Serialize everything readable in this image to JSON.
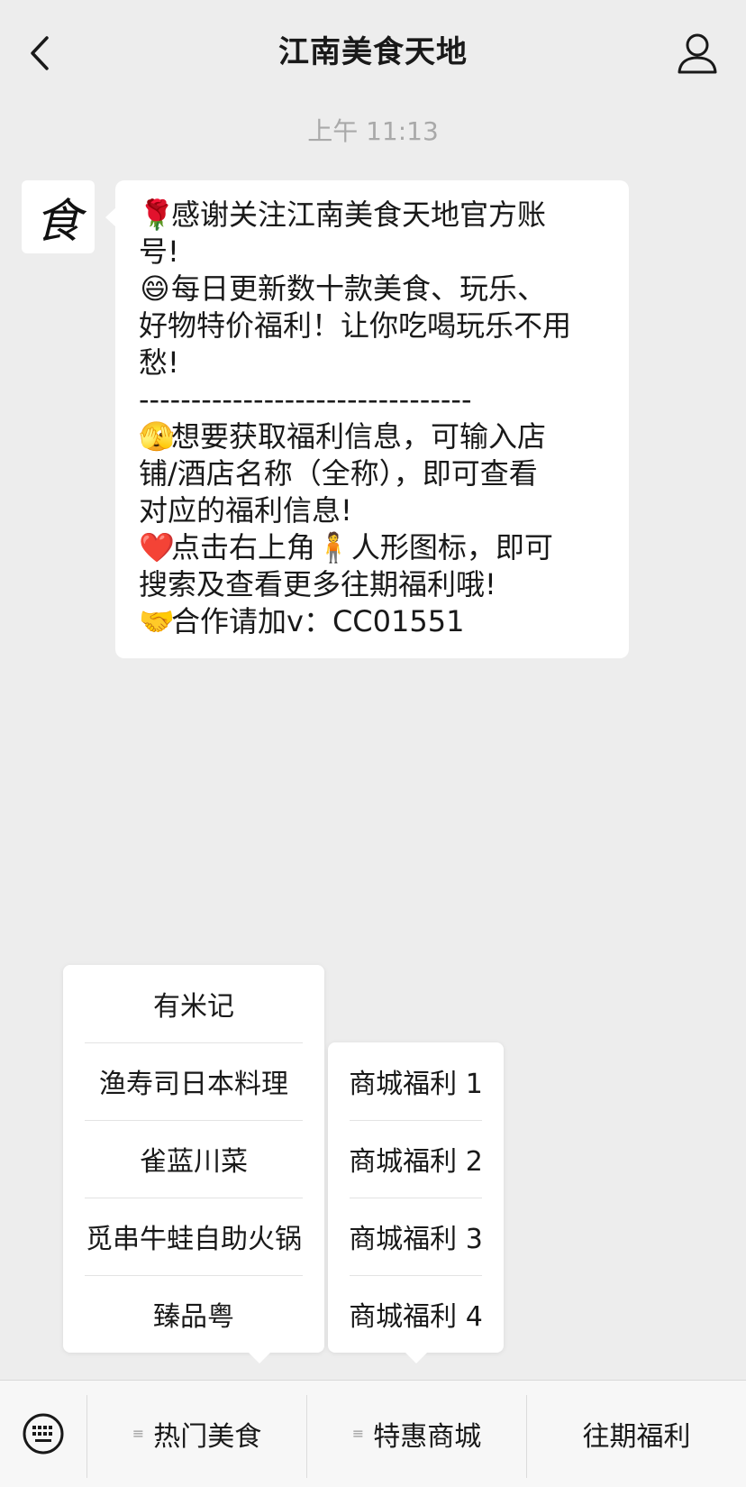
{
  "header": {
    "title": "江南美食天地",
    "back_icon": "chevron-left-icon",
    "profile_icon": "person-icon"
  },
  "chat": {
    "timestamp": "上午 11:13",
    "avatar_char": "食",
    "message_lines": [
      {
        "emoji": "🌹",
        "text": "感谢关注江南美食天地官方账"
      },
      {
        "emoji": "",
        "text": "号!"
      },
      {
        "emoji": "😄",
        "text": "每日更新数十款美食、玩乐、"
      },
      {
        "emoji": "",
        "text": "好物特价福利！让你吃喝玩乐不用"
      },
      {
        "emoji": "",
        "text": "愁!"
      },
      {
        "emoji": "",
        "text": "--------------------------------"
      },
      {
        "emoji": "🫣",
        "text": "想要获取福利信息，可输入店"
      },
      {
        "emoji": "",
        "text": "铺/酒店名称（全称），即可查看"
      },
      {
        "emoji": "",
        "text": "对应的福利信息!"
      },
      {
        "emoji": "❤️",
        "text": "点击右上角🧍人形图标，即可"
      },
      {
        "emoji": "",
        "text": "搜索及查看更多往期福利哦!"
      },
      {
        "emoji": "🤝",
        "text": "合作请加v：CC01551"
      }
    ]
  },
  "popup_hot_food": {
    "items": [
      "有米记",
      "渔寿司日本料理",
      "雀蓝川菜",
      "觅串牛蛙自助火锅",
      "臻品粤"
    ]
  },
  "popup_mall": {
    "items": [
      "商城福利 1",
      "商城福利 2",
      "商城福利 3",
      "商城福利 4"
    ]
  },
  "menu": {
    "keyboard_icon": "keyboard-icon",
    "items": [
      {
        "label": "热门美食",
        "has_submenu": true
      },
      {
        "label": "特惠商城",
        "has_submenu": true
      },
      {
        "label": "往期福利",
        "has_submenu": false
      }
    ]
  }
}
